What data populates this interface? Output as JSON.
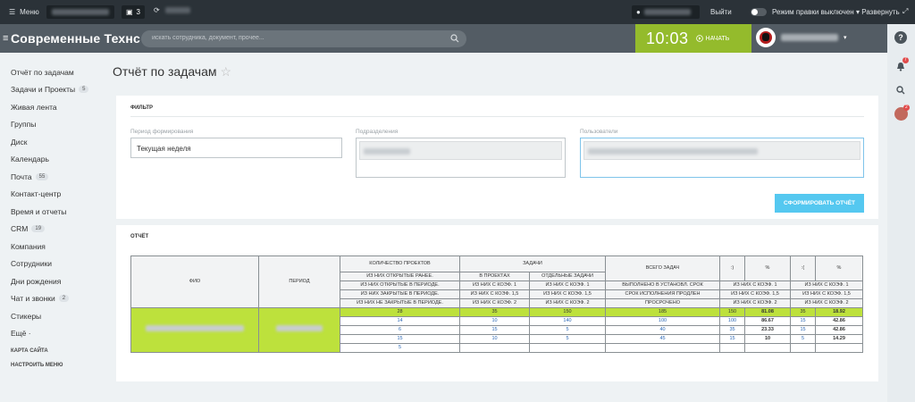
{
  "topbar": {
    "menu_label": "Меню",
    "messages_count": "3",
    "logout_label": "Выйти",
    "mode_label": "Режим правки",
    "mode_state": "выключен",
    "expand_label": "Развернуть"
  },
  "header": {
    "company": "Современные Технс",
    "search_placeholder": "искать сотрудника, документ, прочее...",
    "time": "10:03",
    "start_label": "НАЧАТЬ"
  },
  "sidebar": {
    "items": [
      {
        "label": "Отчёт по задачам",
        "count": ""
      },
      {
        "label": "Задачи и Проекты",
        "count": "5"
      },
      {
        "label": "Живая лента",
        "count": ""
      },
      {
        "label": "Группы",
        "count": ""
      },
      {
        "label": "Диск",
        "count": ""
      },
      {
        "label": "Календарь",
        "count": ""
      },
      {
        "label": "Почта",
        "count": "55"
      },
      {
        "label": "Контакт-центр",
        "count": ""
      },
      {
        "label": "Время и отчеты",
        "count": ""
      },
      {
        "label": "CRM",
        "count": "19"
      },
      {
        "label": "Компания",
        "count": ""
      },
      {
        "label": "Сотрудники",
        "count": ""
      },
      {
        "label": "Дни рождения",
        "count": ""
      },
      {
        "label": "Чат и звонки",
        "count": "2"
      },
      {
        "label": "Стикеры",
        "count": ""
      },
      {
        "label": "Ещё ·",
        "count": ""
      }
    ],
    "site_map": "КАРТА САЙТА",
    "settings": "НАСТРОИТЬ МЕНЮ"
  },
  "rightbar": {
    "help": "?",
    "notifications_badge": "7",
    "profile_badge": "2"
  },
  "page": {
    "title": "Отчёт по задачам"
  },
  "filter": {
    "title": "ФИЛЬТР",
    "period_label": "Период формирования",
    "period_value": "Текущая неделя",
    "department_label": "Подразделения",
    "users_label": "Пользователи",
    "submit_label": "СФОРМИРОВАТЬ ОТЧЁТ"
  },
  "report": {
    "title": "ОТЧЁТ",
    "col_fio": "ФИО",
    "col_period": "ПЕРИОД",
    "col_count_projects": "КОЛИЧЕСТВО ПРОЕКТОВ",
    "col_tasks": "ЗАДАЧИ",
    "col_in_projects": "В ПРОЕКТАХ",
    "col_separate": "ОТДЕЛЬНЫЕ ЗАДАЧИ",
    "col_total": "ВСЕГО ЗАДАЧ",
    "col_colon_1": ":)",
    "col_pct_1": "%",
    "col_colon_2": ":(",
    "col_pct_2": "%",
    "sub": {
      "open_earlier": "ИЗ НИХ ОТКРЫТЫЕ РАНЕЕ.",
      "open_in_period": "ИЗ НИХ ОТКРЫТЫЕ В ПЕРИОДЕ.",
      "closed_in_period": "ИЗ НИХ ЗАКРЫТЫЕ В ПЕРИОДЕ.",
      "not_closed": "ИЗ НИХ НЕ ЗАКРЫТЫЕ В ПЕРИОДЕ.",
      "coef1": "ИЗ НИХ С КОЭФ. 1",
      "coef15": "ИЗ НИХ С КОЭФ. 1,5",
      "coef2": "ИЗ НИХ С КОЭФ. 2",
      "done_on_time": "ВЫПОЛНЕНО В УСТАНОВЛ. СРОК",
      "extended": "СРОК ИСПОЛНЕНИЯ ПРОДЛЕН",
      "overdue": "ПРОСРОЧЕНО"
    },
    "rows": [
      {
        "projects": "28",
        "in_projects": "35",
        "separate": "150",
        "total": "185",
        "good": "150",
        "good_pct": "81.08",
        "bad": "35",
        "bad_pct": "18.92"
      },
      {
        "projects": "14",
        "in_projects": "10",
        "separate": "140",
        "total": "100",
        "good": "100",
        "good_pct": "86.67",
        "bad": "15",
        "bad_pct": "42.86"
      },
      {
        "projects": "6",
        "in_projects": "15",
        "separate": "5",
        "total": "40",
        "good": "35",
        "good_pct": "23.33",
        "bad": "15",
        "bad_pct": "42.86"
      },
      {
        "projects": "15",
        "in_projects": "10",
        "separate": "5",
        "total": "45",
        "good": "15",
        "good_pct": "10",
        "bad": "5",
        "bad_pct": "14.29"
      },
      {
        "projects": "5",
        "in_projects": "",
        "separate": "",
        "total": "",
        "good": "",
        "good_pct": "",
        "bad": "",
        "bad_pct": ""
      }
    ]
  },
  "colors": {
    "topbar": "#2b3238",
    "header": "#535c64",
    "clock": "#94bb2c",
    "button": "#55c8f0",
    "highlight_row": "#bde13c"
  }
}
